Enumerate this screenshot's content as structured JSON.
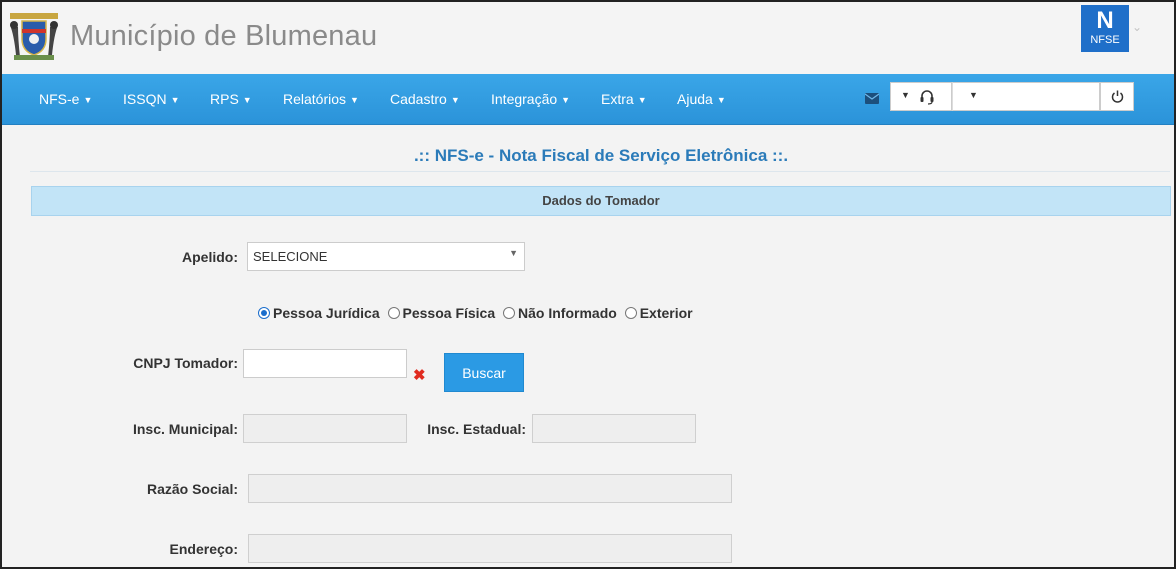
{
  "header": {
    "title": "Município de Blumenau",
    "logo_letter": "N",
    "logo_text": "NFSE"
  },
  "nav": {
    "items": [
      {
        "label": "NFS-e"
      },
      {
        "label": "ISSQN"
      },
      {
        "label": "RPS"
      },
      {
        "label": "Relatórios"
      },
      {
        "label": "Cadastro"
      },
      {
        "label": "Integração"
      },
      {
        "label": "Extra"
      },
      {
        "label": "Ajuda"
      }
    ]
  },
  "main": {
    "heading": ".:: NFS-e - Nota Fiscal de Serviço Eletrônica ::.",
    "section_title": "Dados do Tomador",
    "apelido_label": "Apelido:",
    "apelido_value": "SELECIONE",
    "radio_options": [
      {
        "label": "Pessoa Jurídica",
        "checked": true
      },
      {
        "label": "Pessoa Física",
        "checked": false
      },
      {
        "label": "Não Informado",
        "checked": false
      },
      {
        "label": "Exterior",
        "checked": false
      }
    ],
    "cnpj_label": "CNPJ Tomador:",
    "cnpj_value": "",
    "search_button": "Buscar",
    "insc_municipal_label": "Insc. Municipal:",
    "insc_estadual_label": "Insc. Estadual:",
    "razao_social_label": "Razão Social:",
    "endereco_label": "Endereço:"
  },
  "colors": {
    "navbar": "#2b93d9",
    "heading": "#2b7bb9",
    "section_bar": "#c2e4f7",
    "button": "#2b9ae4",
    "clear_icon": "#e02b1f"
  }
}
